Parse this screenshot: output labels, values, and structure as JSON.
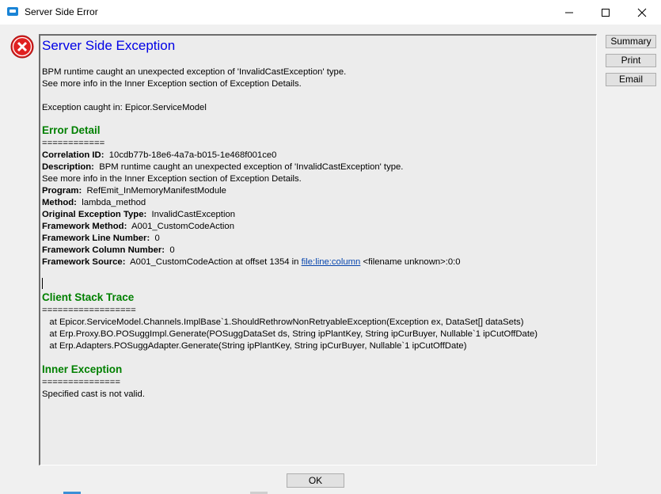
{
  "window": {
    "title": "Server Side Error",
    "icon": "app-icon",
    "controls": [
      "minimize-icon",
      "maximize-icon",
      "close-icon"
    ]
  },
  "header": {
    "icon": "error-icon",
    "heading": "Server Side Exception",
    "message_line1": "BPM runtime caught an unexpected exception of 'InvalidCastException' type.",
    "message_line2": "See more info in the Inner Exception section of Exception Details.",
    "caught_in": "Exception caught in: Epicor.ServiceModel"
  },
  "error_detail": {
    "heading": "Error Detail",
    "rule": "============",
    "fields": [
      {
        "label": "Correlation ID:",
        "value": "10cdb77b-18e6-4a7a-b015-1e468f001ce0"
      },
      {
        "label": "Description:",
        "value": "BPM runtime caught an unexpected exception of 'InvalidCastException' type."
      },
      {
        "label": "",
        "value": "See more info in the Inner Exception section of Exception Details."
      },
      {
        "label": "Program:",
        "value": "RefEmit_InMemoryManifestModule"
      },
      {
        "label": "Method:",
        "value": "lambda_method"
      },
      {
        "label": "Original Exception Type:",
        "value": "InvalidCastException"
      },
      {
        "label": "Framework Method:",
        "value": "A001_CustomCodeAction"
      },
      {
        "label": "Framework Line Number:",
        "value": "0"
      },
      {
        "label": "Framework Column Number:",
        "value": "0"
      }
    ],
    "source_label": "Framework Source:",
    "source_value": "A001_CustomCodeAction at offset 1354 in",
    "source_link": "file:line:column",
    "source_tail": "<filename unknown>:0:0"
  },
  "client_stack_trace": {
    "heading": "Client Stack Trace",
    "rule": "==================",
    "lines": [
      "   at Epicor.ServiceModel.Channels.ImplBase`1.ShouldRethrowNonRetryableException(Exception ex, DataSet[] dataSets)",
      "   at Erp.Proxy.BO.POSuggImpl.Generate(POSuggDataSet ds, String ipPlantKey, String ipCurBuyer, Nullable`1 ipCutOffDate)",
      "   at Erp.Adapters.POSuggAdapter.Generate(String ipPlantKey, String ipCurBuyer, Nullable`1 ipCutOffDate)"
    ]
  },
  "inner_exception": {
    "heading": "Inner Exception",
    "rule": "===============",
    "text": "Specified cast is not valid."
  },
  "side_buttons": [
    "Summary",
    "Print",
    "Email"
  ],
  "ok_label": "OK",
  "colors": {
    "heading_blue": "#0000e6",
    "section_green": "#008000",
    "link": "#0645ad",
    "error_red": "#e02020"
  }
}
